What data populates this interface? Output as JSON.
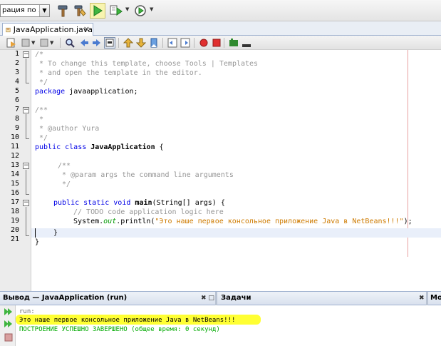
{
  "toolbar": {
    "config_value": "рация по ..."
  },
  "tab": {
    "title": "JavaApplication.java",
    "close": "×"
  },
  "editor": {
    "line_numbers": [
      "1",
      "2",
      "3",
      "4",
      "5",
      "6",
      "7",
      "8",
      "9",
      "10",
      "11",
      "12",
      "13",
      "14",
      "15",
      "16",
      "17",
      "18",
      "19",
      "20",
      "21"
    ],
    "code": {
      "l1": "/*",
      "l2": " * To change this template, choose Tools | Templates",
      "l3": " * and open the template in the editor.",
      "l4": " */",
      "l5_kw": "package",
      "l5_rest": " javaapplication;",
      "l7": "/**",
      "l8": " *",
      "l9": " * @author Yura",
      "l10": " */",
      "l11_kw": "public class",
      "l11_name": "JavaApplication",
      "l11_rest": " {",
      "l13": "/**",
      "l14": " * @param args the command line arguments",
      "l15": " */",
      "l16_kw": "public static void",
      "l16_name": "main",
      "l16_rest": "(String[] args) {",
      "l17": "// TODO code application logic here",
      "l18_a": "System.",
      "l18_fld": "out",
      "l18_b": ".println(",
      "l18_str": "\"Это наше первое консольное приложение Java в NetBeans!!!\"",
      "l18_c": ");",
      "l19": "}",
      "l20": "}"
    }
  },
  "output_panel": {
    "title": "Вывод — JavaApplication (run)",
    "controls": "✖ □",
    "tasks_title": "Задачи",
    "tasks_controls": "✖",
    "third_title": "Мо",
    "lines": {
      "run": "run:",
      "message": "Это наше первое консольное приложение Java в NetBeans!!!",
      "status": "ПОСТРОЕНИЕ УСПЕШНО ЗАВЕРШЕНО (общее время: 0 секунд)"
    }
  },
  "colors": {
    "keyword": "#0000e6",
    "comment": "#969696",
    "string": "#ce7b00",
    "field": "#009900",
    "highlight": "#ffff33",
    "build_success": "#00aa00"
  },
  "icons": [
    "hammer-icon",
    "clean-build-icon",
    "run-icon",
    "debug-icon",
    "profile-icon",
    "back-icon",
    "forward-icon",
    "find-icon",
    "bookmark-icon",
    "comment-icon",
    "macro-icon",
    "rerun-icon",
    "stop-icon"
  ]
}
